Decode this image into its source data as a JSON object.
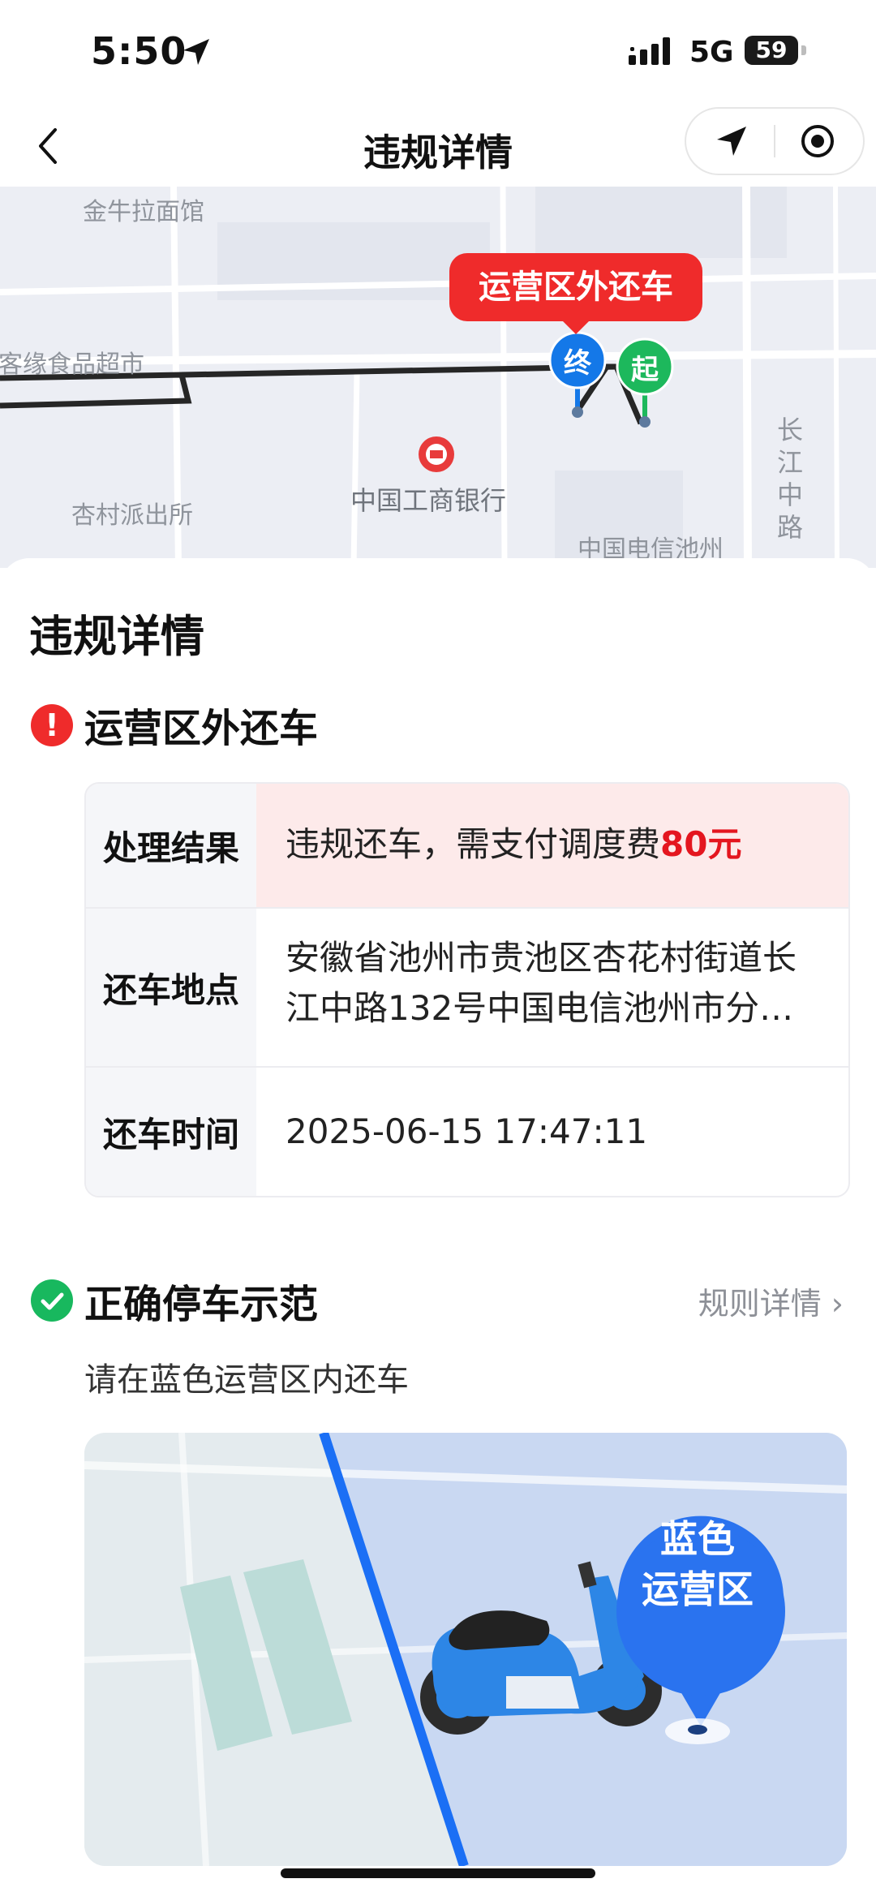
{
  "status_bar": {
    "time": "5:50",
    "network": "5G",
    "battery": "59"
  },
  "nav": {
    "title": "违规详情"
  },
  "map": {
    "labels": [
      "金牛拉面馆",
      "客缘食品超市",
      "杏村派出所",
      "中国工商银行",
      "中国电信池州",
      "长江中路"
    ],
    "bubble": "运营区外还车",
    "end_marker": "终",
    "start_marker": "起"
  },
  "sheet": {
    "title": "违规详情",
    "violation": {
      "title": "运营区外还车"
    },
    "details": [
      {
        "key": "处理结果",
        "value": "违规还车，需支付调度费",
        "highlight": "80元"
      },
      {
        "key": "还车地点",
        "value": "安徽省池州市贵池区杏花村街道长江中路132号中国电信池州市分…"
      },
      {
        "key": "还车时间",
        "value": "2025-06-15 17:47:11"
      }
    ],
    "correct": {
      "title": "正确停车示范",
      "rule_link": "规则详情 ›",
      "hint": "请在蓝色运营区内还车",
      "pin_line1": "蓝色",
      "pin_line2": "运营区"
    }
  },
  "colors": {
    "danger": "#ef2b2b",
    "price": "#e4161f",
    "success": "#18b85e",
    "end_marker": "#1478e8",
    "start_marker": "#1db85c",
    "zone_blue": "#1b6ff5"
  },
  "icons": [
    "location-arrow-icon",
    "signal-icon",
    "back-chevron-icon",
    "navigate-icon",
    "record-icon",
    "bank-icon",
    "warning-icon",
    "check-icon",
    "chevron-right-icon"
  ]
}
